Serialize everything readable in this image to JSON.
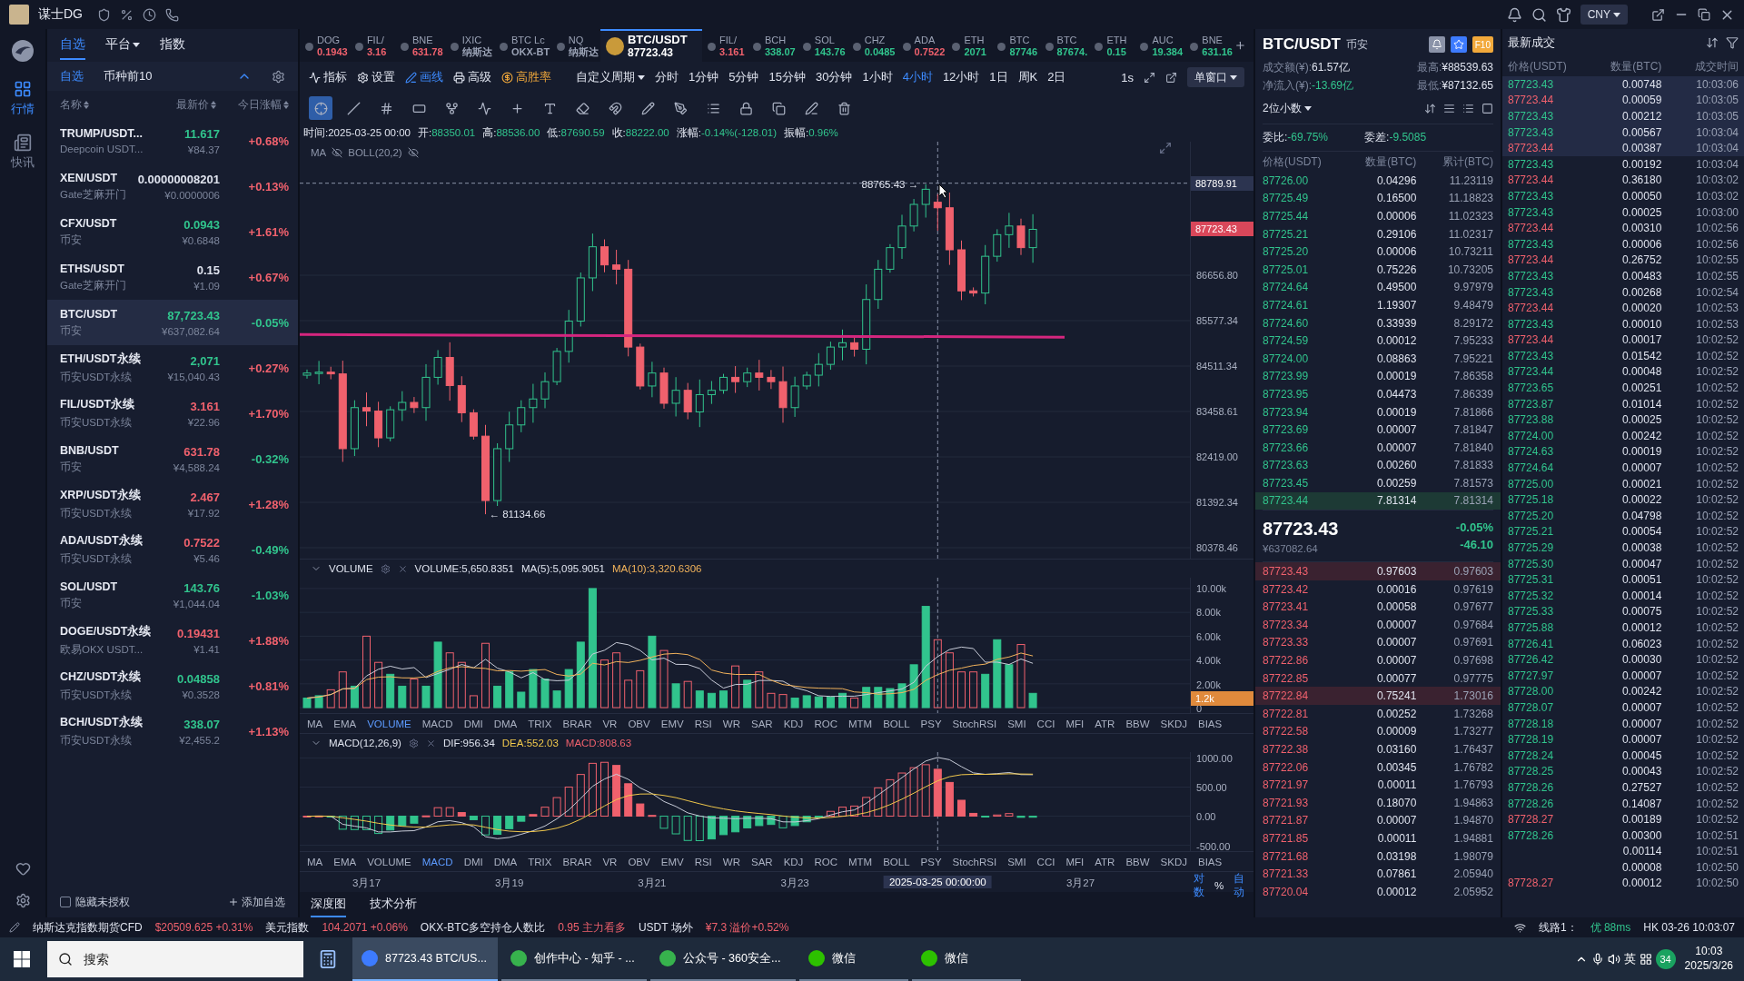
{
  "title_bar": {
    "user_name": "谋士DG",
    "currency": "CNY"
  },
  "nav": [
    {
      "label": "行情",
      "selected": true
    },
    {
      "label": "快讯",
      "selected": false
    }
  ],
  "watchlist": {
    "tabs": [
      {
        "label": "自选",
        "selected": true,
        "has_menu": false
      },
      {
        "label": "平台",
        "selected": false,
        "has_menu": true
      },
      {
        "label": "指数",
        "selected": false,
        "has_menu": false
      }
    ],
    "subtabs": [
      {
        "label": "自选",
        "selected": true
      },
      {
        "label": "币种前10",
        "selected": false
      }
    ],
    "columns": [
      "名称",
      "最新价",
      "今日涨幅"
    ],
    "rows": [
      {
        "pair": "TRUMP/USDT...",
        "source": "Deepcoin USDT...",
        "price": {
          "text": "11.617",
          "color": "#31c48d"
        },
        "cny": "¥84.37",
        "change": {
          "text": "+0.68%",
          "color": "#f0616d"
        },
        "selected": false
      },
      {
        "pair": "XEN/USDT",
        "source": "Gate芝麻开门",
        "price": {
          "text": "0.00000008201",
          "color": "#dfe3ee"
        },
        "cny": "¥0.0000006",
        "change": {
          "text": "+0.13%",
          "color": "#f0616d"
        },
        "selected": false
      },
      {
        "pair": "CFX/USDT",
        "source": "币安",
        "price": {
          "text": "0.0943",
          "color": "#31c48d"
        },
        "cny": "¥0.6848",
        "change": {
          "text": "+1.61%",
          "color": "#f0616d"
        },
        "selected": false
      },
      {
        "pair": "ETHS/USDT",
        "source": "Gate芝麻开门",
        "price": {
          "text": "0.15",
          "color": "#dfe3ee"
        },
        "cny": "¥1.09",
        "change": {
          "text": "+0.67%",
          "color": "#f0616d"
        },
        "selected": false
      },
      {
        "pair": "BTC/USDT",
        "source": "币安",
        "price": {
          "text": "87,723.43",
          "color": "#31c48d"
        },
        "cny": "¥637,082.64",
        "change": {
          "text": "-0.05%",
          "color": "#31c48d"
        },
        "selected": true
      },
      {
        "pair": "ETH/USDT永续",
        "source": "币安USDT永续",
        "price": {
          "text": "2,071",
          "color": "#31c48d"
        },
        "cny": "¥15,040.43",
        "change": {
          "text": "+0.27%",
          "color": "#f0616d"
        },
        "selected": false
      },
      {
        "pair": "FIL/USDT永续",
        "source": "币安USDT永续",
        "price": {
          "text": "3.161",
          "color": "#f0616d"
        },
        "cny": "¥22.96",
        "change": {
          "text": "+1.70%",
          "color": "#f0616d"
        },
        "selected": false
      },
      {
        "pair": "BNB/USDT",
        "source": "币安",
        "price": {
          "text": "631.78",
          "color": "#f0616d"
        },
        "cny": "¥4,588.24",
        "change": {
          "text": "-0.32%",
          "color": "#31c48d"
        },
        "selected": false
      },
      {
        "pair": "XRP/USDT永续",
        "source": "币安USDT永续",
        "price": {
          "text": "2.467",
          "color": "#f0616d"
        },
        "cny": "¥17.92",
        "change": {
          "text": "+1.28%",
          "color": "#f0616d"
        },
        "selected": false
      },
      {
        "pair": "ADA/USDT永续",
        "source": "币安USDT永续",
        "price": {
          "text": "0.7522",
          "color": "#f0616d"
        },
        "cny": "¥5.46",
        "change": {
          "text": "-0.49%",
          "color": "#31c48d"
        },
        "selected": false
      },
      {
        "pair": "SOL/USDT",
        "source": "币安",
        "price": {
          "text": "143.76",
          "color": "#31c48d"
        },
        "cny": "¥1,044.04",
        "change": {
          "text": "-1.03%",
          "color": "#31c48d"
        },
        "selected": false
      },
      {
        "pair": "DOGE/USDT永续",
        "source": "欧易OKX USDT...",
        "price": {
          "text": "0.19431",
          "color": "#f0616d"
        },
        "cny": "¥1.41",
        "change": {
          "text": "+1.88%",
          "color": "#f0616d"
        },
        "selected": false
      },
      {
        "pair": "CHZ/USDT永续",
        "source": "币安USDT永续",
        "price": {
          "text": "0.04858",
          "color": "#31c48d"
        },
        "cny": "¥0.3528",
        "change": {
          "text": "+0.81%",
          "color": "#f0616d"
        },
        "selected": false
      },
      {
        "pair": "BCH/USDT永续",
        "source": "币安USDT永续",
        "price": {
          "text": "338.07",
          "color": "#31c48d"
        },
        "cny": "¥2,455.2",
        "change": {
          "text": "+1.13%",
          "color": "#f0616d"
        },
        "selected": false
      }
    ],
    "hide_unauthorized": {
      "label": "隐藏未授权",
      "checked": false
    },
    "add_button": "添加自选"
  },
  "chart": {
    "symbol_tabs": [
      {
        "symbol": "DOG",
        "price": "0.1943",
        "color": "#f0616d",
        "selected": false
      },
      {
        "symbol": "FIL/",
        "price": "3.16",
        "color": "#f0616d",
        "selected": false
      },
      {
        "symbol": "BNE",
        "price": "631.78",
        "color": "#f0616d",
        "selected": false
      },
      {
        "symbol": "IXIC",
        "price": "纳斯达",
        "color": "#9aa2b5",
        "selected": false
      },
      {
        "symbol": "BTC Lc",
        "price": "OKX-BT",
        "color": "#9aa2b5",
        "selected": false
      },
      {
        "symbol": "NQ",
        "price": "纳斯达",
        "color": "#9aa2b5",
        "selected": false
      },
      {
        "symbol": "BTC/USDT",
        "price": "87723.43",
        "color": "#ffffff",
        "selected": true
      },
      {
        "symbol": "FIL/",
        "price": "3.161",
        "color": "#f0616d",
        "selected": false
      },
      {
        "symbol": "BCH",
        "price": "338.07",
        "color": "#31c48d",
        "selected": false
      },
      {
        "symbol": "SOL",
        "price": "143.76",
        "color": "#31c48d",
        "selected": false
      },
      {
        "symbol": "CHZ",
        "price": "0.0485",
        "color": "#31c48d",
        "selected": false
      },
      {
        "symbol": "ADA",
        "price": "0.7522",
        "color": "#f0616d",
        "selected": false
      },
      {
        "symbol": "ETH",
        "price": "2071",
        "color": "#31c48d",
        "selected": false
      },
      {
        "symbol": "BTC",
        "price": "87746",
        "color": "#31c48d",
        "selected": false
      },
      {
        "symbol": "BTC",
        "price": "87674.",
        "color": "#31c48d",
        "selected": false
      },
      {
        "symbol": "ETH",
        "price": "0.15",
        "color": "#31c48d",
        "selected": false
      },
      {
        "symbol": "AUC",
        "price": "19.384",
        "color": "#31c48d",
        "selected": false
      },
      {
        "symbol": "BNE",
        "price": "631.16",
        "color": "#31c48d",
        "selected": false
      }
    ],
    "toolbar": [
      {
        "label": "指标",
        "kind": "normal"
      },
      {
        "label": "设置",
        "kind": "normal"
      },
      {
        "label": "画线",
        "kind": "active"
      },
      {
        "label": "高级",
        "kind": "normal"
      },
      {
        "label": "高胜率",
        "kind": "highlight"
      }
    ],
    "custom_period": "自定义周期",
    "periods": [
      {
        "label": "分时",
        "selected": false
      },
      {
        "label": "1分钟",
        "selected": false
      },
      {
        "label": "5分钟",
        "selected": false
      },
      {
        "label": "15分钟",
        "selected": false
      },
      {
        "label": "30分钟",
        "selected": false
      },
      {
        "label": "1小时",
        "selected": false
      },
      {
        "label": "4小时",
        "selected": true
      },
      {
        "label": "12小时",
        "selected": false
      },
      {
        "label": "1日",
        "selected": false
      },
      {
        "label": "周K",
        "selected": false
      },
      {
        "label": "2日",
        "selected": false
      }
    ],
    "refresh": "1s",
    "window_mode": "单窗口",
    "draw_tools": [
      {
        "selected": true
      },
      {
        "selected": false
      },
      {
        "selected": false
      },
      {
        "selected": false
      },
      {
        "selected": false
      },
      {
        "selected": false
      },
      {
        "selected": false
      },
      {
        "selected": false
      },
      {
        "selected": false
      },
      {
        "selected": false
      },
      {
        "selected": false
      },
      {
        "selected": false
      },
      {
        "selected": false
      },
      {
        "selected": false
      },
      {
        "selected": false
      },
      {
        "selected": false
      },
      {
        "selected": false
      }
    ],
    "info": [
      {
        "label": "时间:",
        "value": "2025-03-25 00:00",
        "color": "#dfe3ee"
      },
      {
        "label": "开:",
        "value": "88350.01",
        "color": "#31c48d"
      },
      {
        "label": "高:",
        "value": "88536.00",
        "color": "#31c48d"
      },
      {
        "label": "低:",
        "value": "87690.59",
        "color": "#31c48d"
      },
      {
        "label": "收:",
        "value": "88222.00",
        "color": "#31c48d"
      },
      {
        "label": "涨幅:",
        "value": "-0.14%(-128.01)",
        "color": "#31c48d"
      },
      {
        "label": "振幅:",
        "value": "0.96%",
        "color": "#31c48d"
      }
    ],
    "main": {
      "legends": [
        {
          "label": "MA",
          "hidden": true
        },
        {
          "label": "BOLL(20,2)",
          "hidden": true
        }
      ],
      "high_marker": "88765.43 →",
      "low_marker": "← 81134.66",
      "crosshair_price": "88789.91",
      "last_price": "87723.43",
      "axis": [
        "86656.80",
        "85577.34",
        "84511.34",
        "83458.61",
        "82419.00",
        "81392.34",
        "80378.46"
      ]
    },
    "volume": {
      "title": "VOLUME",
      "legend": [
        {
          "text": "VOLUME:5,650.8351",
          "color": "#dfe3ee"
        },
        {
          "text": "MA(5):5,095.9051",
          "color": "#dfe3ee"
        },
        {
          "text": "MA(10):3,320.6306",
          "color": "#f2b35b"
        }
      ],
      "axis": [
        "10.00k",
        "8.00k",
        "6.00k",
        "4.00k",
        "2.00k",
        "0"
      ],
      "last_tag": "1.2k"
    },
    "indicators_1": [
      {
        "label": "MA",
        "selected": false
      },
      {
        "label": "EMA",
        "selected": false
      },
      {
        "label": "VOLUME",
        "selected": true
      },
      {
        "label": "MACD",
        "selected": false
      },
      {
        "label": "DMI",
        "selected": false
      },
      {
        "label": "DMA",
        "selected": false
      },
      {
        "label": "TRIX",
        "selected": false
      },
      {
        "label": "BRAR",
        "selected": false
      },
      {
        "label": "VR",
        "selected": false
      },
      {
        "label": "OBV",
        "selected": false
      },
      {
        "label": "EMV",
        "selected": false
      },
      {
        "label": "RSI",
        "selected": false
      },
      {
        "label": "WR",
        "selected": false
      },
      {
        "label": "SAR",
        "selected": false
      },
      {
        "label": "KDJ",
        "selected": false
      },
      {
        "label": "ROC",
        "selected": false
      },
      {
        "label": "MTM",
        "selected": false
      },
      {
        "label": "BOLL",
        "selected": false
      },
      {
        "label": "PSY",
        "selected": false
      },
      {
        "label": "StochRSI",
        "selected": false
      },
      {
        "label": "SMI",
        "selected": false
      },
      {
        "label": "CCI",
        "selected": false
      },
      {
        "label": "MFI",
        "selected": false
      },
      {
        "label": "ATR",
        "selected": false
      },
      {
        "label": "BBW",
        "selected": false
      },
      {
        "label": "SKDJ",
        "selected": false
      },
      {
        "label": "BIAS",
        "selected": false
      }
    ],
    "macd": {
      "title": "MACD(12,26,9)",
      "legend": [
        {
          "text": "DIF:956.34",
          "color": "#dfe3ee"
        },
        {
          "text": "DEA:552.03",
          "color": "#f2c94c"
        },
        {
          "text": "MACD:808.63",
          "color": "#f0616d"
        }
      ],
      "axis": [
        "1000.00",
        "500.00",
        "0.00",
        "-500.00"
      ]
    },
    "indicators_2": [
      {
        "label": "MA",
        "selected": false
      },
      {
        "label": "EMA",
        "selected": false
      },
      {
        "label": "VOLUME",
        "selected": false
      },
      {
        "label": "MACD",
        "selected": true
      },
      {
        "label": "DMI",
        "selected": false
      },
      {
        "label": "DMA",
        "selected": false
      },
      {
        "label": "TRIX",
        "selected": false
      },
      {
        "label": "BRAR",
        "selected": false
      },
      {
        "label": "VR",
        "selected": false
      },
      {
        "label": "OBV",
        "selected": false
      },
      {
        "label": "EMV",
        "selected": false
      },
      {
        "label": "RSI",
        "selected": false
      },
      {
        "label": "WR",
        "selected": false
      },
      {
        "label": "SAR",
        "selected": false
      },
      {
        "label": "KDJ",
        "selected": false
      },
      {
        "label": "ROC",
        "selected": false
      },
      {
        "label": "MTM",
        "selected": false
      },
      {
        "label": "BOLL",
        "selected": false
      },
      {
        "label": "PSY",
        "selected": false
      },
      {
        "label": "StochRSI",
        "selected": false
      },
      {
        "label": "SMI",
        "selected": false
      },
      {
        "label": "CCI",
        "selected": false
      },
      {
        "label": "MFI",
        "selected": false
      },
      {
        "label": "ATR",
        "selected": false
      },
      {
        "label": "BBW",
        "selected": false
      },
      {
        "label": "SKDJ",
        "selected": false
      },
      {
        "label": "BIAS",
        "selected": false
      }
    ],
    "x_axis": [
      {
        "label": "3月17",
        "crosshair": false
      },
      {
        "label": "3月19",
        "crosshair": false
      },
      {
        "label": "3月21",
        "crosshair": false
      },
      {
        "label": "3月23",
        "crosshair": false
      },
      {
        "label": "2025-03-25 00:00:00",
        "crosshair": true
      },
      {
        "label": "3月27",
        "crosshair": false
      }
    ],
    "scale_options": [
      {
        "label": "对数",
        "selected": true
      },
      {
        "label": "%",
        "selected": false
      },
      {
        "label": "自动",
        "selected": true
      }
    ],
    "bottom_tabs": [
      {
        "label": "深度图",
        "selected": true
      },
      {
        "label": "技术分析",
        "selected": false
      }
    ]
  },
  "order_book": {
    "symbol": "BTC/USDT",
    "exchange": "币安",
    "badge": "F10",
    "stats": [
      {
        "label": "成交额(¥):",
        "value": "61.57亿",
        "color": "#dfe3ee"
      },
      {
        "label": "净流入(¥):",
        "value": "-13.69亿",
        "color": "#31c48d"
      }
    ],
    "extremes": [
      {
        "label": "最高:",
        "value": "¥88539.63"
      },
      {
        "label": "最低:",
        "value": "¥87132.65"
      }
    ],
    "precision": "2位小数",
    "ratios": [
      {
        "label": "委比:",
        "value": "-69.75%"
      },
      {
        "label": "委差:",
        "value": "-9.5085"
      }
    ],
    "columns": [
      "价格(USDT)",
      "数量(BTC)",
      "累计(BTC)"
    ],
    "asks": [
      {
        "price": "87726.00",
        "qty": "0.04296",
        "total": "11.23119",
        "highlighted": false
      },
      {
        "price": "87725.49",
        "qty": "0.16500",
        "total": "11.18823",
        "highlighted": false
      },
      {
        "price": "87725.44",
        "qty": "0.00006",
        "total": "11.02323",
        "highlighted": false
      },
      {
        "price": "87725.21",
        "qty": "0.29106",
        "total": "11.02317",
        "highlighted": false
      },
      {
        "price": "87725.20",
        "qty": "0.00006",
        "total": "10.73211",
        "highlighted": false
      },
      {
        "price": "87725.01",
        "qty": "0.75226",
        "total": "10.73205",
        "highlighted": false
      },
      {
        "price": "87724.64",
        "qty": "0.49500",
        "total": "9.97979",
        "highlighted": false
      },
      {
        "price": "87724.61",
        "qty": "1.19307",
        "total": "9.48479",
        "highlighted": false
      },
      {
        "price": "87724.60",
        "qty": "0.33939",
        "total": "8.29172",
        "highlighted": false
      },
      {
        "price": "87724.59",
        "qty": "0.00012",
        "total": "7.95233",
        "highlighted": false
      },
      {
        "price": "87724.00",
        "qty": "0.08863",
        "total": "7.95221",
        "highlighted": false
      },
      {
        "price": "87723.99",
        "qty": "0.00019",
        "total": "7.86358",
        "highlighted": false
      },
      {
        "price": "87723.95",
        "qty": "0.04473",
        "total": "7.86339",
        "highlighted": false
      },
      {
        "price": "87723.94",
        "qty": "0.00019",
        "total": "7.81866",
        "highlighted": false
      },
      {
        "price": "87723.69",
        "qty": "0.00007",
        "total": "7.81847",
        "highlighted": false
      },
      {
        "price": "87723.66",
        "qty": "0.00007",
        "total": "7.81840",
        "highlighted": false
      },
      {
        "price": "87723.63",
        "qty": "0.00260",
        "total": "7.81833",
        "highlighted": false
      },
      {
        "price": "87723.45",
        "qty": "0.00259",
        "total": "7.81573",
        "highlighted": false
      },
      {
        "price": "87723.44",
        "qty": "7.81314",
        "total": "7.81314",
        "highlighted": true
      }
    ],
    "last": {
      "price": "87723.43",
      "cny": "¥637082.64",
      "change": "-0.05%",
      "change_value": "-46.10"
    },
    "bids": [
      {
        "price": "87723.43",
        "qty": "0.97603",
        "total": "0.97603",
        "highlighted": true
      },
      {
        "price": "87723.42",
        "qty": "0.00016",
        "total": "0.97619",
        "highlighted": false
      },
      {
        "price": "87723.41",
        "qty": "0.00058",
        "total": "0.97677",
        "highlighted": false
      },
      {
        "price": "87723.34",
        "qty": "0.00007",
        "total": "0.97684",
        "highlighted": false
      },
      {
        "price": "87723.33",
        "qty": "0.00007",
        "total": "0.97691",
        "highlighted": false
      },
      {
        "price": "87722.86",
        "qty": "0.00007",
        "total": "0.97698",
        "highlighted": false
      },
      {
        "price": "87722.85",
        "qty": "0.00077",
        "total": "0.97775",
        "highlighted": false
      },
      {
        "price": "87722.84",
        "qty": "0.75241",
        "total": "1.73016",
        "highlighted": true
      },
      {
        "price": "87722.81",
        "qty": "0.00252",
        "total": "1.73268",
        "highlighted": false
      },
      {
        "price": "87722.58",
        "qty": "0.00009",
        "total": "1.73277",
        "highlighted": false
      },
      {
        "price": "87722.38",
        "qty": "0.03160",
        "total": "1.76437",
        "highlighted": false
      },
      {
        "price": "87722.06",
        "qty": "0.00345",
        "total": "1.76782",
        "highlighted": false
      },
      {
        "price": "87721.97",
        "qty": "0.00011",
        "total": "1.76793",
        "highlighted": false
      },
      {
        "price": "87721.93",
        "qty": "0.18070",
        "total": "1.94863",
        "highlighted": false
      },
      {
        "price": "87721.87",
        "qty": "0.00007",
        "total": "1.94870",
        "highlighted": false
      },
      {
        "price": "87721.85",
        "qty": "0.00011",
        "total": "1.94881",
        "highlighted": false
      },
      {
        "price": "87721.68",
        "qty": "0.03198",
        "total": "1.98079",
        "highlighted": false
      },
      {
        "price": "87721.33",
        "qty": "0.07861",
        "total": "2.05940",
        "highlighted": false
      },
      {
        "price": "87720.04",
        "qty": "0.00012",
        "total": "2.05952",
        "highlighted": false
      }
    ]
  },
  "trades": {
    "title": "最新成交",
    "columns": [
      "价格(USDT)",
      "数量(BTC)",
      "成交时间"
    ],
    "rows": [
      {
        "price": "87723.43",
        "qty": "0.00748",
        "time": "10:03:06",
        "color": "#31c48d",
        "highlighted": true
      },
      {
        "price": "87723.44",
        "qty": "0.00059",
        "time": "10:03:05",
        "color": "#f0616d",
        "highlighted": true
      },
      {
        "price": "87723.43",
        "qty": "0.00212",
        "time": "10:03:05",
        "color": "#31c48d",
        "highlighted": true
      },
      {
        "price": "87723.43",
        "qty": "0.00567",
        "time": "10:03:04",
        "color": "#31c48d",
        "highlighted": true
      },
      {
        "price": "87723.44",
        "qty": "0.00387",
        "time": "10:03:04",
        "color": "#f0616d",
        "highlighted": true
      },
      {
        "price": "87723.43",
        "qty": "0.00192",
        "time": "10:03:04",
        "color": "#31c48d",
        "highlighted": false
      },
      {
        "price": "87723.44",
        "qty": "0.36180",
        "time": "10:03:02",
        "color": "#f0616d",
        "highlighted": false
      },
      {
        "price": "87723.43",
        "qty": "0.00050",
        "time": "10:03:02",
        "color": "#31c48d",
        "highlighted": false
      },
      {
        "price": "87723.43",
        "qty": "0.00025",
        "time": "10:03:00",
        "color": "#31c48d",
        "highlighted": false
      },
      {
        "price": "87723.44",
        "qty": "0.00310",
        "time": "10:02:56",
        "color": "#f0616d",
        "highlighted": false
      },
      {
        "price": "87723.43",
        "qty": "0.00006",
        "time": "10:02:56",
        "color": "#31c48d",
        "highlighted": false
      },
      {
        "price": "87723.44",
        "qty": "0.26752",
        "time": "10:02:55",
        "color": "#f0616d",
        "highlighted": false
      },
      {
        "price": "87723.43",
        "qty": "0.00483",
        "time": "10:02:55",
        "color": "#31c48d",
        "highlighted": false
      },
      {
        "price": "87723.43",
        "qty": "0.00268",
        "time": "10:02:54",
        "color": "#31c48d",
        "highlighted": false
      },
      {
        "price": "87723.44",
        "qty": "0.00020",
        "time": "10:02:53",
        "color": "#f0616d",
        "highlighted": false
      },
      {
        "price": "87723.43",
        "qty": "0.00010",
        "time": "10:02:53",
        "color": "#31c48d",
        "highlighted": false
      },
      {
        "price": "87723.44",
        "qty": "0.00017",
        "time": "10:02:52",
        "color": "#f0616d",
        "highlighted": false
      },
      {
        "price": "87723.43",
        "qty": "0.01542",
        "time": "10:02:52",
        "color": "#31c48d",
        "highlighted": false
      },
      {
        "price": "87723.44",
        "qty": "0.00048",
        "time": "10:02:52",
        "color": "#31c48d",
        "highlighted": false
      },
      {
        "price": "87723.65",
        "qty": "0.00251",
        "time": "10:02:52",
        "color": "#31c48d",
        "highlighted": false
      },
      {
        "price": "87723.87",
        "qty": "0.01014",
        "time": "10:02:52",
        "color": "#31c48d",
        "highlighted": false
      },
      {
        "price": "87723.88",
        "qty": "0.00025",
        "time": "10:02:52",
        "color": "#31c48d",
        "highlighted": false
      },
      {
        "price": "87724.00",
        "qty": "0.00242",
        "time": "10:02:52",
        "color": "#31c48d",
        "highlighted": false
      },
      {
        "price": "87724.63",
        "qty": "0.00019",
        "time": "10:02:52",
        "color": "#31c48d",
        "highlighted": false
      },
      {
        "price": "87724.64",
        "qty": "0.00007",
        "time": "10:02:52",
        "color": "#31c48d",
        "highlighted": false
      },
      {
        "price": "87725.00",
        "qty": "0.00021",
        "time": "10:02:52",
        "color": "#31c48d",
        "highlighted": false
      },
      {
        "price": "87725.18",
        "qty": "0.00022",
        "time": "10:02:52",
        "color": "#31c48d",
        "highlighted": false
      },
      {
        "price": "87725.20",
        "qty": "0.04798",
        "time": "10:02:52",
        "color": "#31c48d",
        "highlighted": false
      },
      {
        "price": "87725.21",
        "qty": "0.00054",
        "time": "10:02:52",
        "color": "#31c48d",
        "highlighted": false
      },
      {
        "price": "87725.29",
        "qty": "0.00038",
        "time": "10:02:52",
        "color": "#31c48d",
        "highlighted": false
      },
      {
        "price": "87725.30",
        "qty": "0.00047",
        "time": "10:02:52",
        "color": "#31c48d",
        "highlighted": false
      },
      {
        "price": "87725.31",
        "qty": "0.00051",
        "time": "10:02:52",
        "color": "#31c48d",
        "highlighted": false
      },
      {
        "price": "87725.32",
        "qty": "0.00014",
        "time": "10:02:52",
        "color": "#31c48d",
        "highlighted": false
      },
      {
        "price": "87725.33",
        "qty": "0.00075",
        "time": "10:02:52",
        "color": "#31c48d",
        "highlighted": false
      },
      {
        "price": "87725.88",
        "qty": "0.00012",
        "time": "10:02:52",
        "color": "#31c48d",
        "highlighted": false
      },
      {
        "price": "87726.41",
        "qty": "0.06023",
        "time": "10:02:52",
        "color": "#31c48d",
        "highlighted": false
      },
      {
        "price": "87726.42",
        "qty": "0.00030",
        "time": "10:02:52",
        "color": "#31c48d",
        "highlighted": false
      },
      {
        "price": "87727.97",
        "qty": "0.00007",
        "time": "10:02:52",
        "color": "#31c48d",
        "highlighted": false
      },
      {
        "price": "87728.00",
        "qty": "0.00242",
        "time": "10:02:52",
        "color": "#31c48d",
        "highlighted": false
      },
      {
        "price": "87728.07",
        "qty": "0.00007",
        "time": "10:02:52",
        "color": "#31c48d",
        "highlighted": false
      },
      {
        "price": "87728.18",
        "qty": "0.00007",
        "time": "10:02:52",
        "color": "#31c48d",
        "highlighted": false
      },
      {
        "price": "87728.19",
        "qty": "0.00007",
        "time": "10:02:52",
        "color": "#31c48d",
        "highlighted": false
      },
      {
        "price": "87728.24",
        "qty": "0.00045",
        "time": "10:02:52",
        "color": "#31c48d",
        "highlighted": false
      },
      {
        "price": "87728.25",
        "qty": "0.00043",
        "time": "10:02:52",
        "color": "#31c48d",
        "highlighted": false
      },
      {
        "price": "87728.26",
        "qty": "0.27527",
        "time": "10:02:52",
        "color": "#31c48d",
        "highlighted": false
      },
      {
        "price": "87728.26",
        "qty": "0.14087",
        "time": "10:02:52",
        "color": "#31c48d",
        "highlighted": false
      },
      {
        "price": "87728.27",
        "qty": "0.00189",
        "time": "10:02:52",
        "color": "#f0616d",
        "highlighted": false
      },
      {
        "price": "87728.26",
        "qty": "0.00300",
        "time": "10:02:51",
        "color": "#31c48d",
        "highlighted": false
      },
      {
        "qty": "0.00114",
        "time": "10:02:51",
        "highlighted": false
      },
      {
        "qty": "0.00008",
        "time": "10:02:50",
        "highlighted": false
      },
      {
        "price": "87728.27",
        "qty": "0.00012",
        "time": "10:02:50",
        "color": "#f0616d",
        "highlighted": false
      }
    ]
  },
  "status_bar": {
    "tickers": [
      {
        "name": "纳斯达克指数期货CFD",
        "value": "$20509.625 +0.31%",
        "color": "#f0616d"
      },
      {
        "name": "美元指数",
        "value": "104.2071 +0.06%",
        "color": "#f0616d"
      },
      {
        "name": "OKX-BTC多空持仓人数比",
        "value": "0.95 主力看多",
        "color": "#f0616d"
      },
      {
        "name": "USDT 场外",
        "value": "¥7.3 溢价+0.52%",
        "color": "#f0616d"
      }
    ],
    "line_label": "线路1：",
    "line_quality": "优 88ms",
    "clock": "HK 03-26 10:03:07"
  },
  "taskbar": {
    "search_placeholder": "搜索",
    "apps": [
      {
        "label": "87723.43 BTC/US...",
        "selected": true
      },
      {
        "label": "创作中心 - 知乎 - ...",
        "selected": false
      },
      {
        "label": "公众号 - 360安全...",
        "selected": false
      },
      {
        "label": "微信",
        "selected": false
      },
      {
        "label": "微信",
        "selected": false
      }
    ],
    "ime": "英",
    "badge": "34",
    "time": "10:03",
    "date": "2025/3/26"
  }
}
